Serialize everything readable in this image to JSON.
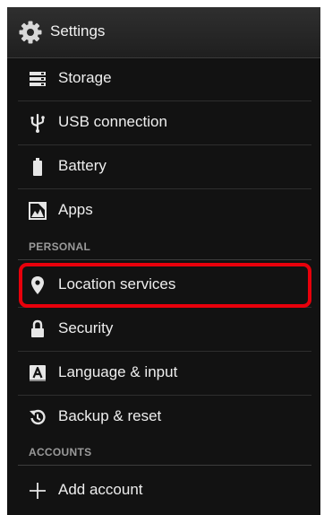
{
  "actionbar": {
    "title": "Settings",
    "icon": "gear-icon"
  },
  "items": [
    {
      "label": "Storage",
      "icon": "storage-icon"
    },
    {
      "label": "USB connection",
      "icon": "usb-icon"
    },
    {
      "label": "Battery",
      "icon": "battery-icon"
    },
    {
      "label": "Apps",
      "icon": "apps-icon"
    }
  ],
  "personal": {
    "title": "PERSONAL",
    "items": [
      {
        "label": "Location services",
        "icon": "location-pin-icon",
        "highlighted": true
      },
      {
        "label": "Security",
        "icon": "lock-icon"
      },
      {
        "label": "Language & input",
        "icon": "language-icon"
      },
      {
        "label": "Backup & reset",
        "icon": "backup-icon"
      }
    ]
  },
  "accounts": {
    "title": "ACCOUNTS",
    "items": [
      {
        "label": "Add account",
        "icon": "plus-icon"
      }
    ]
  },
  "colors": {
    "highlight": "#e8000b",
    "background": "#121212"
  }
}
